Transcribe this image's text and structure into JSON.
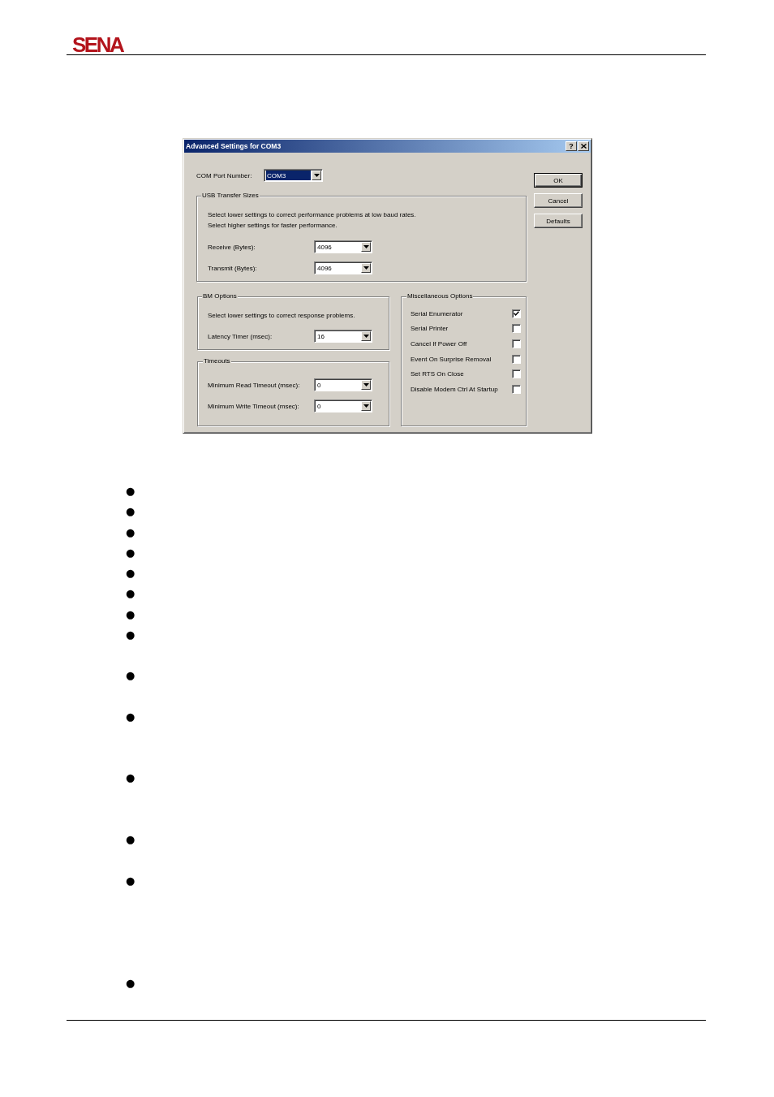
{
  "header": {
    "logo": "SENA"
  },
  "dialog": {
    "title": "Advanced Settings for COM3",
    "help_button": "?",
    "com_port": {
      "label": "COM Port Number:",
      "value": "COM3",
      "highlighted": true
    },
    "usb_transfer_sizes": {
      "title": "USB Transfer Sizes",
      "notes": [
        "Select lower settings to correct performance problems at low baud rates.",
        "Select higher settings for faster performance."
      ],
      "fields": [
        {
          "label": "Receive (Bytes):",
          "value": "4096"
        },
        {
          "label": "Transmit (Bytes):",
          "value": "4096"
        }
      ]
    },
    "bm_options": {
      "title": "BM Options",
      "notes": [
        "Select lower settings to correct response problems."
      ],
      "fields": [
        {
          "label": "Latency Timer (msec):",
          "value": "16"
        }
      ]
    },
    "timeouts": {
      "title": "Timeouts",
      "fields": [
        {
          "label": "Minimum Read Timeout (msec):",
          "value": "0"
        },
        {
          "label": "Minimum Write Timeout (msec):",
          "value": "0"
        }
      ]
    },
    "miscellaneous_options": {
      "title": "Miscellaneous Options",
      "options": [
        {
          "label": "Serial Enumerator",
          "checked": true
        },
        {
          "label": "Serial Printer",
          "checked": false
        },
        {
          "label": "Cancel If Power Off",
          "checked": false
        },
        {
          "label": "Event On Surprise Removal",
          "checked": false
        },
        {
          "label": "Set RTS On Close",
          "checked": false
        },
        {
          "label": "Disable Modem Ctrl At Startup",
          "checked": false
        }
      ]
    },
    "buttons": [
      {
        "label": "OK",
        "default": true
      },
      {
        "label": "Cancel",
        "default": false
      },
      {
        "label": "Defaults",
        "default": false
      }
    ]
  },
  "bullet_list": [
    {
      "marker": "●"
    },
    {
      "marker": "●"
    },
    {
      "marker": "●"
    },
    {
      "marker": "●"
    },
    {
      "marker": "●"
    },
    {
      "marker": "●"
    },
    {
      "marker": "●"
    },
    {
      "marker": "●"
    },
    {
      "marker": "●"
    },
    {
      "marker": "●"
    },
    {
      "marker": "●"
    },
    {
      "marker": "●"
    },
    {
      "marker": "●"
    },
    {
      "marker": "●"
    }
  ]
}
